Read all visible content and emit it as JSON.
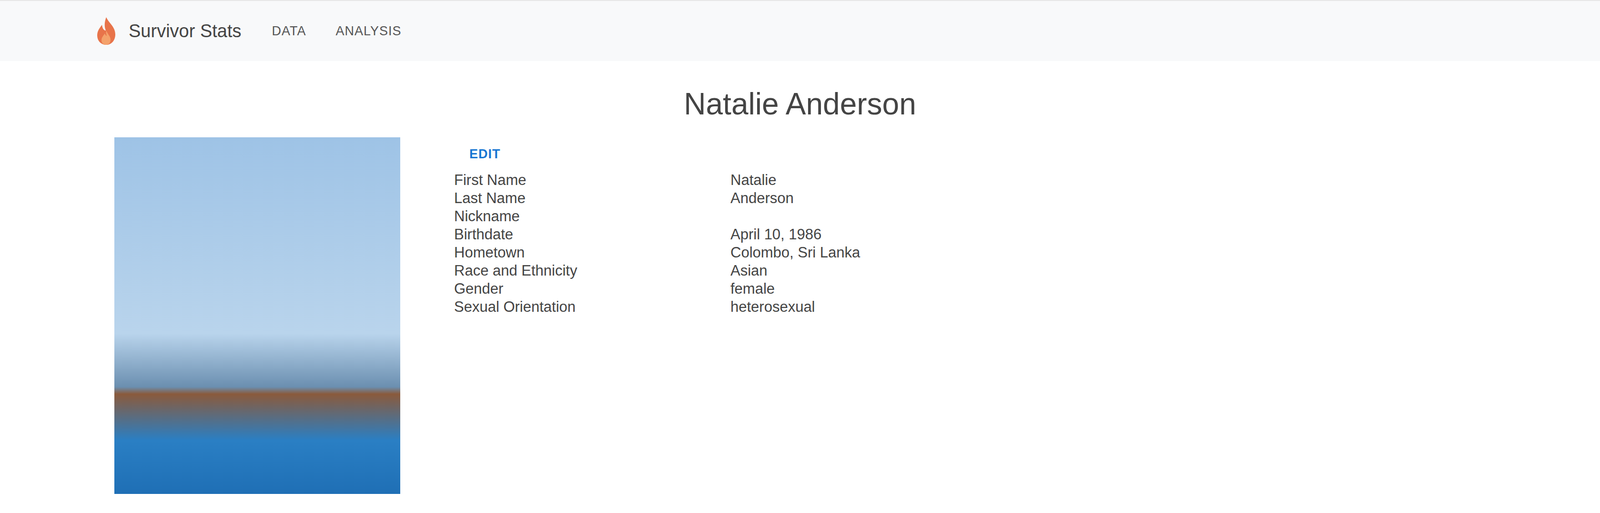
{
  "navbar": {
    "brand": "Survivor Stats",
    "links": [
      "DATA",
      "ANALYSIS"
    ]
  },
  "page": {
    "title": "Natalie Anderson",
    "edit_button": "EDIT"
  },
  "details": [
    {
      "label": "First Name",
      "value": "Natalie"
    },
    {
      "label": "Last Name",
      "value": "Anderson"
    },
    {
      "label": "Nickname",
      "value": ""
    },
    {
      "label": "Birthdate",
      "value": "April 10, 1986"
    },
    {
      "label": "Hometown",
      "value": "Colombo, Sri Lanka"
    },
    {
      "label": "Race and Ethnicity",
      "value": "Asian"
    },
    {
      "label": "Gender",
      "value": "female"
    },
    {
      "label": "Sexual Orientation",
      "value": "heterosexual"
    }
  ]
}
